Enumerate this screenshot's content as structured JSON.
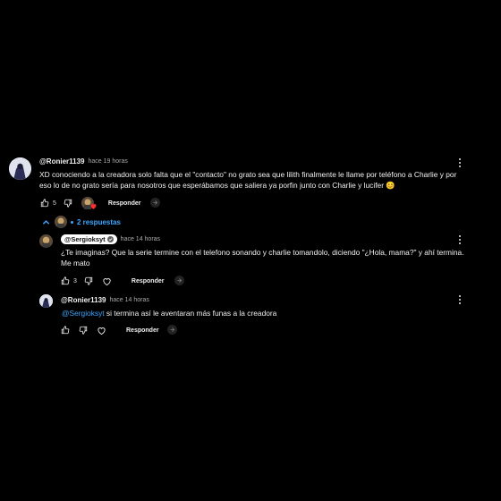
{
  "comments": [
    {
      "handle": "@Ronier1139",
      "time": "hace 19 horas",
      "text": "XD conociendo a la creadora solo falta que el \"contacto\" no grato sea que lilith finalmente le llame por teléfono a Charlie y por eso lo de no grato sería para nosotros que esperábamos que saliera ya porfin junto con Charlie y lucifer 😊",
      "likes": "5",
      "reply_label": "Responder"
    }
  ],
  "replies_toggle": {
    "label": "2 respuestas"
  },
  "replies": [
    {
      "handle": "@Sergioksyt",
      "time": "hace 14 horas",
      "text": "¿Te imaginas? Que la serie termine con el telefono sonando y charlie tomandolo, diciendo \"¿Hola, mama?\" y ahí termina. Me mato",
      "likes": "3",
      "reply_label": "Responder"
    },
    {
      "handle": "@Ronier1139",
      "time": "hace 14 horas",
      "mention": "@Sergioksyt",
      "text": " si termina así le aventaran más funas a la creadora",
      "reply_label": "Responder"
    }
  ],
  "colors": {
    "background": "#000000",
    "link": "#3ea6ff",
    "text": "#f1f1f1",
    "meta": "#aaaaaa"
  }
}
